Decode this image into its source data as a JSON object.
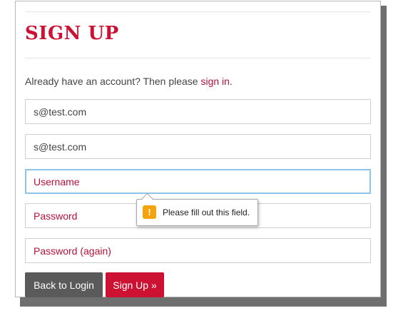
{
  "heading": "SIGN UP",
  "intro": {
    "text": "Already have an account? Then please ",
    "link_label": "sign in",
    "suffix": "."
  },
  "fields": {
    "email": {
      "value": "s@test.com"
    },
    "email_confirm": {
      "value": "s@test.com"
    },
    "username": {
      "placeholder": "Username"
    },
    "password": {
      "placeholder": "Password"
    },
    "password_again": {
      "placeholder": "Password (again)"
    }
  },
  "buttons": {
    "back_label": "Back to Login",
    "signup_label": "Sign Up »"
  },
  "validation_tooltip": {
    "message": "Please fill out this field.",
    "icon": "warning-icon",
    "icon_glyph": "!",
    "icon_color": "#f4a30d"
  },
  "colors": {
    "accent": "#cc1133",
    "link": "#b5123a",
    "focus_border": "#8ec3ea",
    "secondary_button": "#5a5a5a"
  }
}
